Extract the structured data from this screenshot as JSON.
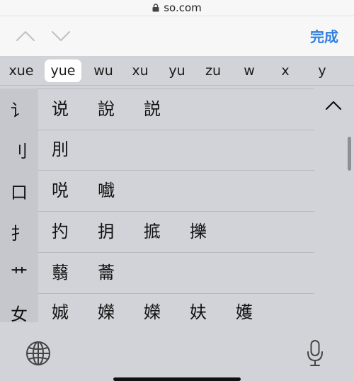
{
  "browser": {
    "url": "so.com"
  },
  "toolbar": {
    "done_label": "完成"
  },
  "pinyin_candidates": [
    "xue",
    "yue",
    "wu",
    "xu",
    "yu",
    "zu",
    "w",
    "x",
    "y"
  ],
  "selected_candidate": "yue",
  "radical_rows": [
    {
      "radical": "讠",
      "chars": [
        "说",
        "說",
        "説"
      ]
    },
    {
      "radical": "刂",
      "chars": [
        "刖"
      ]
    },
    {
      "radical": "口",
      "chars": [
        "哾",
        "嚱"
      ]
    },
    {
      "radical": "扌",
      "chars": [
        "扚",
        "抈",
        "掋",
        "擽"
      ]
    },
    {
      "radical": "艹",
      "chars": [
        "蘙",
        "蘥"
      ]
    },
    {
      "radical": "女",
      "chars": [
        "娍",
        "嬫",
        "嬫",
        "妋",
        "嬳"
      ]
    }
  ],
  "icons": {
    "lock": "lock-icon",
    "prev": "chevron-up-icon",
    "next": "chevron-down-icon",
    "collapse": "chevron-up-icon",
    "globe": "globe-icon",
    "mic": "microphone-icon"
  },
  "colors": {
    "accent": "#2f7fe0",
    "keyboard_bg": "#d2d3d9",
    "radical_bg": "#c6c7cd"
  }
}
